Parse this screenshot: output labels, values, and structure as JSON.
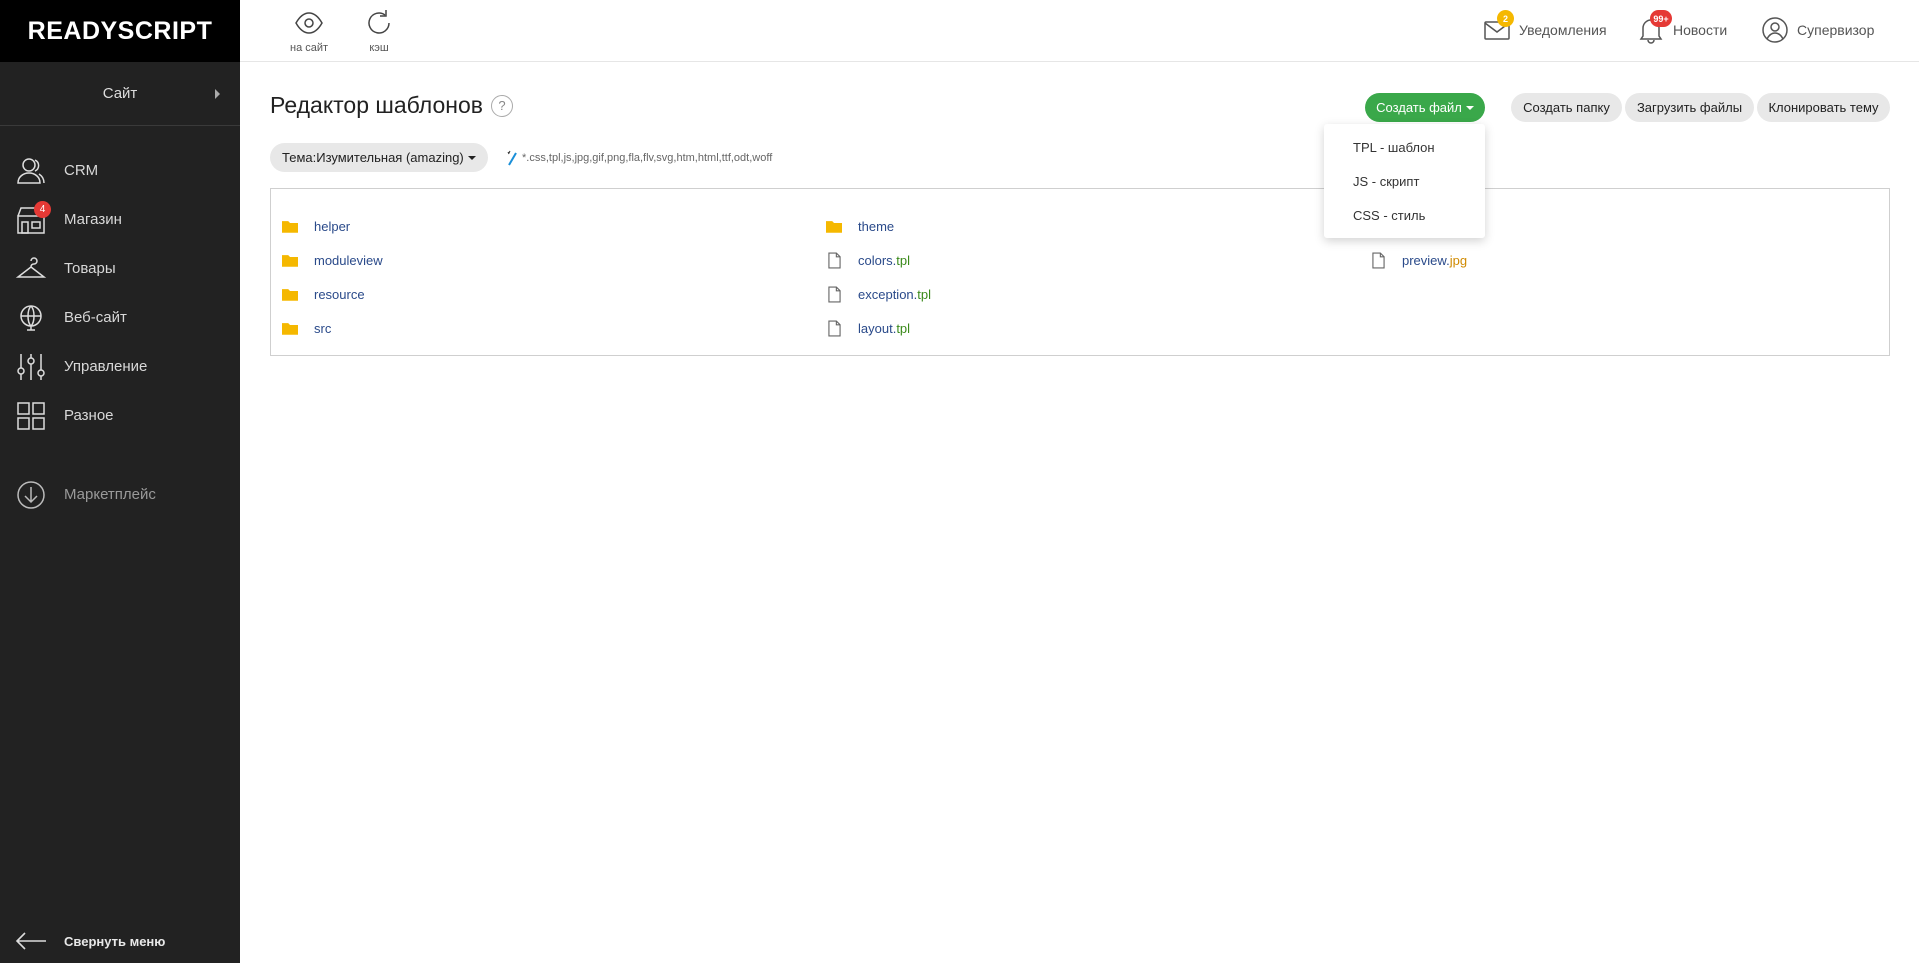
{
  "logo": "READYSCRIPT",
  "sidebar": {
    "site_selector": "Сайт",
    "items": [
      {
        "label": "CRM",
        "icon": "users-icon"
      },
      {
        "label": "Магазин",
        "icon": "store-icon",
        "badge": "4"
      },
      {
        "label": "Товары",
        "icon": "hanger-icon"
      },
      {
        "label": "Веб-сайт",
        "icon": "globe-icon"
      },
      {
        "label": "Управление",
        "icon": "sliders-icon"
      },
      {
        "label": "Разное",
        "icon": "grid-icon"
      }
    ],
    "marketplace": {
      "label": "Маркетплейс",
      "icon": "download-circle-icon"
    },
    "collapse_label": "Свернуть меню"
  },
  "topbar": {
    "to_site_label": "на сайт",
    "cache_label": "кэш",
    "notifications": {
      "label": "Уведомления",
      "badge": "2"
    },
    "news": {
      "label": "Новости",
      "badge": "99+"
    },
    "user": {
      "label": "Супервизор"
    }
  },
  "page": {
    "title": "Редактор шаблонов",
    "help": "?",
    "buttons": {
      "create_file": "Создать файл",
      "create_folder": "Создать папку",
      "upload_files": "Загрузить файлы",
      "clone_theme": "Клонировать тему"
    },
    "create_file_menu": [
      "TPL - шаблон",
      "JS - скрипт",
      "CSS - стиль"
    ],
    "theme_select": "Тема:Изумительная (amazing)",
    "filter": "*.css,tpl,js,jpg,gif,png,fla,flv,svg,htm,html,ttf,odt,woff"
  },
  "files": {
    "col1": [
      {
        "type": "folder",
        "name": "helper",
        "ext": ""
      },
      {
        "type": "folder",
        "name": "moduleview",
        "ext": ""
      },
      {
        "type": "folder",
        "name": "resource",
        "ext": ""
      },
      {
        "type": "folder",
        "name": "src",
        "ext": ""
      }
    ],
    "col2": [
      {
        "type": "folder",
        "name": "theme",
        "ext": ""
      },
      {
        "type": "file",
        "name": "colors.",
        "ext": "tpl"
      },
      {
        "type": "file",
        "name": "exception.",
        "ext": "tpl"
      },
      {
        "type": "file",
        "name": "layout.",
        "ext": "tpl"
      }
    ],
    "col3": [
      {
        "type": "file",
        "name": "preview.",
        "ext": "jpg"
      }
    ]
  },
  "colors": {
    "accent_green": "#3aa84a",
    "folder": "#f5b800",
    "badge_red": "#e53935",
    "badge_yellow": "#f5b800"
  }
}
